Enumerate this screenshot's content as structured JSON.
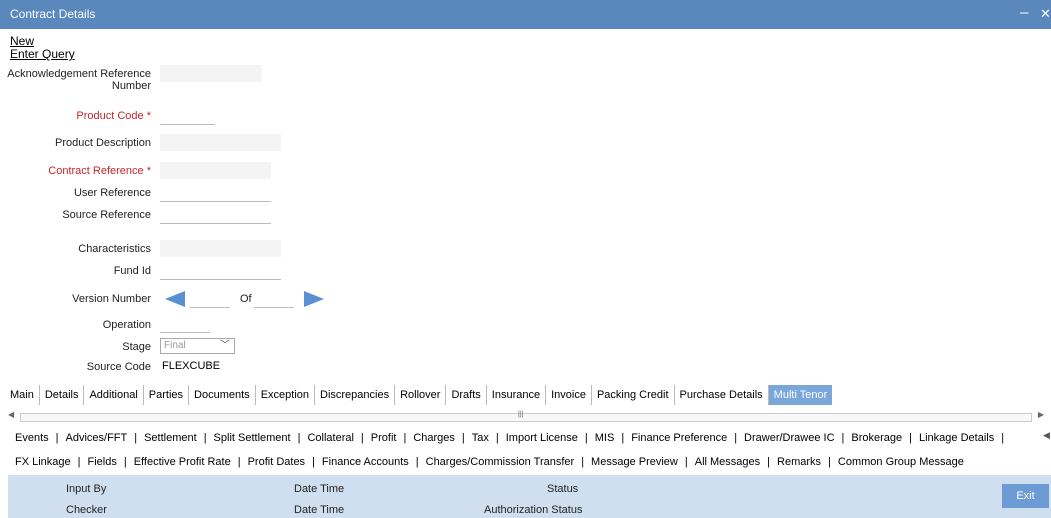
{
  "window": {
    "title": "Contract Details",
    "minimize_glyph": "–",
    "close_glyph": "✕"
  },
  "menu": {
    "new": "New",
    "enter_query": "Enter Query"
  },
  "form": {
    "ack_ref_line1": "Acknowledgement Reference",
    "ack_ref_line2": "Number",
    "product_code": "Product Code",
    "product_description": "Product Description",
    "contract_reference": "Contract Reference",
    "user_reference": "User Reference",
    "source_reference": "Source Reference",
    "characteristics": "Characteristics",
    "fund_id": "Fund Id",
    "version_number": "Version Number",
    "of_label": "Of",
    "operation": "Operation",
    "stage": "Stage",
    "stage_value": "Final",
    "source_code": "Source Code",
    "source_code_value": "FLEXCUBE",
    "required_mark": "*"
  },
  "tabs": [
    "Main",
    "Details",
    "Additional",
    "Parties",
    "Documents",
    "Exception",
    "Discrepancies",
    "Rollover",
    "Drafts",
    "Insurance",
    "Invoice",
    "Packing Credit",
    "Purchase Details",
    "Multi Tenor"
  ],
  "active_tab": "Multi Tenor",
  "links_row1": [
    "Events",
    "Advices/FFT",
    "Settlement",
    "Split Settlement",
    "Collateral",
    "Profit",
    "Charges",
    "Tax",
    "Import License",
    "MIS",
    "Finance Preference",
    "Drawer/Drawee IC",
    "Brokerage",
    "Linkage Details"
  ],
  "links_row2": [
    "FX Linkage",
    "Fields",
    "Effective Profit Rate",
    "Profit Dates",
    "Finance Accounts",
    "Charges/Commission Transfer",
    "Message Preview",
    "All Messages",
    "Remarks",
    "Common Group Message"
  ],
  "footer": {
    "input_by": "Input By",
    "date_time": "Date Time",
    "status": "Status",
    "checker": "Checker",
    "authorization_status": "Authorization Status",
    "exit": "Exit"
  },
  "colors": {
    "titlebar": "#5a88bd",
    "required": "#c0272d",
    "active_tab": "#7aa6d9",
    "footer": "#cfdfef",
    "exit_button": "#6d9bd3",
    "arrow": "#5b8fd4"
  },
  "icons": {
    "prev": "triangle-left-icon",
    "next": "triangle-right-icon",
    "dropdown": "chevron-down-icon",
    "scroll_left": "scroll-left-icon",
    "scroll_right": "scroll-right-icon"
  }
}
